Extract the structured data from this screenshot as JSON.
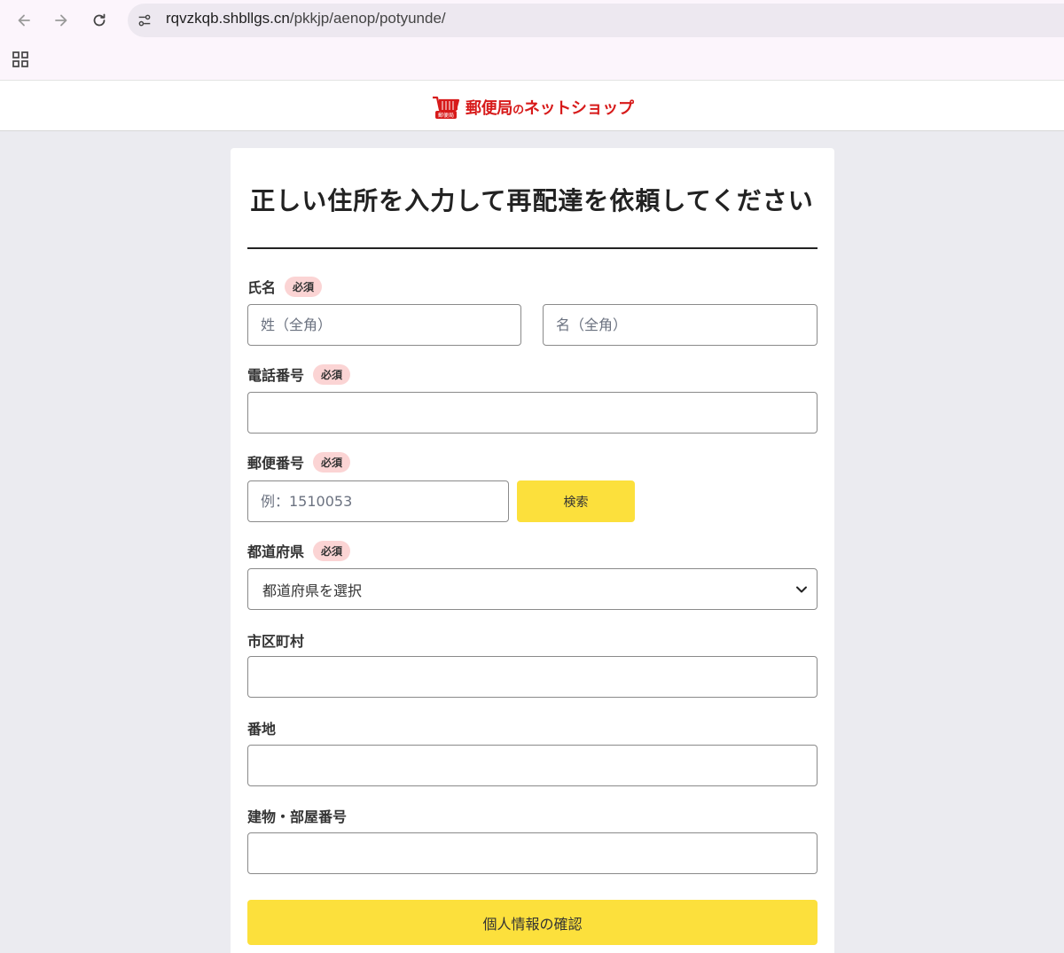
{
  "browser": {
    "url_host": "rqvzkqb.shbllgs.cn",
    "url_path": "/pkkjp/aenop/potyunde/"
  },
  "site": {
    "logo_main": "郵便局",
    "logo_no": "の",
    "logo_sub": "ネットショップ",
    "logo_cart_text": "郵便局"
  },
  "form": {
    "title": "正しい住所を入力して再配達を依頼してください",
    "required_badge": "必須",
    "name": {
      "label": "氏名",
      "last_placeholder": "姓（全角）",
      "first_placeholder": "名（全角）"
    },
    "phone": {
      "label": "電話番号",
      "placeholder": ""
    },
    "postal": {
      "label": "郵便番号",
      "placeholder": "例：1510053",
      "search_button": "検索"
    },
    "prefecture": {
      "label": "都道府県",
      "selected": "都道府県を選択"
    },
    "city": {
      "label": "市区町村"
    },
    "street": {
      "label": "番地"
    },
    "building": {
      "label": "建物・部屋番号"
    },
    "confirm_button": "個人情報の確認"
  },
  "colors": {
    "accent_yellow": "#fce03c",
    "badge_pink": "#fbd4d4",
    "logo_red": "#d71a1a"
  }
}
